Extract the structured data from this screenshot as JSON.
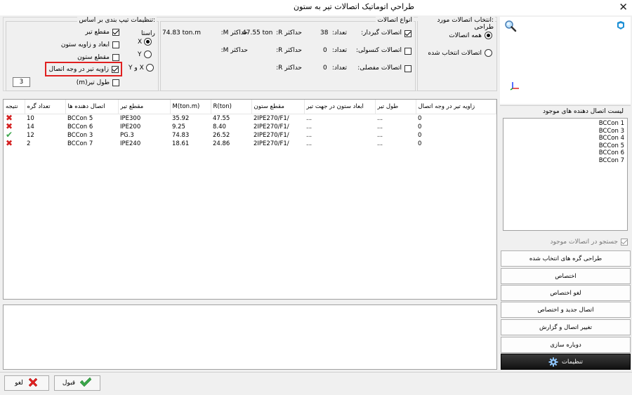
{
  "window": {
    "title": "طراحي اتوماتيک اتصالات تير به ستون",
    "close_glyph": "✕"
  },
  "connection_select": {
    "title": ":انتخاب اتصالات مورد طراحی",
    "all_label": "همه اتصالات",
    "selected_label": "اتصالات انتخاب شده"
  },
  "connection_types": {
    "title": "انواع اتصالات",
    "rows": [
      {
        "label": "اتصالات گیردار:",
        "count_label": "تعداد:",
        "count": "38",
        "maxr_label": "حداکثر R:",
        "maxr": "47.55 ton",
        "maxm_label": "حداکثر M:",
        "maxm": "74.83 ton.m",
        "checked": true
      },
      {
        "label": "اتصالات کنسولی:",
        "count_label": "تعداد:",
        "count": "0",
        "maxr_label": "حداکثر R:",
        "maxr": "",
        "maxm_label": "حداکثر M:",
        "maxm": "",
        "checked": false
      },
      {
        "label": "اتصالات مفصلی:",
        "count_label": "تعداد:",
        "count": "0",
        "maxr_label": "حداکثر R:",
        "maxr": "",
        "maxm_label": "",
        "maxm": "",
        "checked": false
      }
    ]
  },
  "type_settings": {
    "title": ":تنظیمات تیپ بندی بر اساس",
    "options": [
      {
        "label": "مقطع تیر",
        "checked": true
      },
      {
        "label": "ابعاد و زاویه ستون",
        "checked": false
      },
      {
        "label": "مقطع ستون",
        "checked": false
      },
      {
        "label": "زاویه تیر در وجه اتصال",
        "checked": true
      },
      {
        "label": "طول تیر(m)",
        "checked": false
      }
    ],
    "direction_title": "راستا",
    "directions": [
      {
        "label": "X",
        "selected": true
      },
      {
        "label": "Y",
        "selected": false
      },
      {
        "label": "X و Y",
        "selected": false
      }
    ],
    "length_value": "3",
    "highlight_color": "#e02020"
  },
  "table": {
    "headers": [
      "نتیجه",
      "تعداد گره",
      "اتصال دهنده ها",
      "مقطع تیر",
      "M(ton.m)",
      "R(ton)",
      "مقطع ستون",
      "ابعاد ستون در جهت تیر",
      "طول تیر",
      "زاویه تیر در وجه اتصال"
    ],
    "rows": [
      {
        "result": "fail",
        "nodes": "10",
        "connector": "BCCon 5",
        "beam": "IPE300",
        "m": "35.92",
        "r": "47.55",
        "column": "2IPE270/F1/",
        "dims": "...",
        "length": "...",
        "angle": "0"
      },
      {
        "result": "fail",
        "nodes": "14",
        "connector": "BCCon 6",
        "beam": "IPE200",
        "m": "9.25",
        "r": "8.40",
        "column": "2IPE270/F1/",
        "dims": "...",
        "length": "...",
        "angle": "0"
      },
      {
        "result": "pass",
        "nodes": "12",
        "connector": "BCCon 3",
        "beam": "PG.3",
        "m": "74.83",
        "r": "26.52",
        "column": "2IPE270/F1/",
        "dims": "...",
        "length": "...",
        "angle": "0"
      },
      {
        "result": "fail",
        "nodes": "2",
        "connector": "BCCon 7",
        "beam": "IPE240",
        "m": "18.61",
        "r": "24.86",
        "column": "2IPE270/F1/",
        "dims": "...",
        "length": "...",
        "angle": "0"
      }
    ]
  },
  "connectors": {
    "title": "لیست اتصال دهنده های موجود",
    "items": [
      "BCCon 1",
      "BCCon 3",
      "BCCon 4",
      "BCCon 5",
      "BCCon 6",
      "BCCon 7"
    ],
    "search_label": "جستجو در اتصالات موجود"
  },
  "actions": {
    "design_selected": "طراحی گره های انتخاب شده",
    "assign": "اختصاص",
    "unassign": "لغو اختصاص",
    "new_assign": "اتصال جدید و اختصاص",
    "change_report": "تغییر اتصال و گزارش",
    "rebuild": "دوباره سازی",
    "settings": "تنظیمات"
  },
  "footer": {
    "cancel": "لغو",
    "ok": "قبول"
  },
  "colors": {
    "fail": "#d42020",
    "pass": "#3aa54a",
    "accent_blue": "#1e90d6"
  }
}
